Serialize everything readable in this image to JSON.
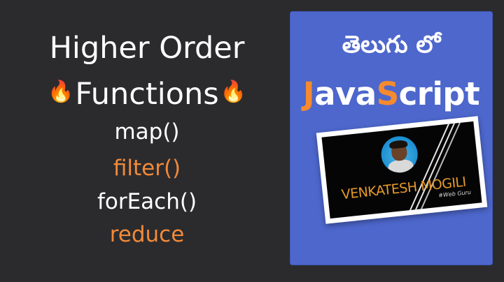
{
  "left": {
    "title_line1": "Higher Order",
    "title_line2": "Functions",
    "flame_left": "🔥",
    "flame_right": "🔥",
    "functions": [
      "map()",
      "filter()",
      "forEach()",
      "reduce"
    ]
  },
  "card": {
    "telugu_text": "తెలుగు లో",
    "js_parts": [
      "J",
      "ava",
      "S",
      "cript"
    ],
    "photo_name": "VENKATESH MOGILI",
    "photo_tag": "#Web Guru"
  },
  "colors": {
    "background": "#2b2b2d",
    "accent_orange": "#f28a3a",
    "card_blue": "#4d67cc"
  }
}
